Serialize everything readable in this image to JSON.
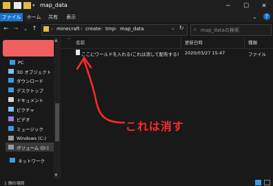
{
  "window": {
    "title": "map_data"
  },
  "ribbon": {
    "tabs": [
      "ファイル",
      "ホーム",
      "共有",
      "表示"
    ]
  },
  "address": {
    "crumbs": [
      "minecraft",
      "create",
      "tmp",
      "map_data"
    ]
  },
  "search": {
    "placeholder": "map_dataの検索"
  },
  "nav": {
    "items": [
      "PC",
      "3D オブジェクト",
      "ダウンロード",
      "デスクトップ",
      "ドキュメント",
      "ピクチャ",
      "ビデオ",
      "ミュージック",
      "Windows (C:)",
      "ボリューム (D:)",
      "ネットワーク"
    ]
  },
  "columns": {
    "name": "名前",
    "date": "更新日時",
    "type": "種類"
  },
  "files": [
    {
      "name": "ここにワールドを入れる(これは消して配布する)",
      "date": "2020/03/27 15:47",
      "type": "ファイル"
    }
  ],
  "annotation": {
    "text": "これは消す",
    "color": "#ff2a2a"
  },
  "status": {
    "count": "1 個の項目"
  },
  "colors": {
    "accent": "#1a73c9",
    "folder": "#e8b844"
  }
}
